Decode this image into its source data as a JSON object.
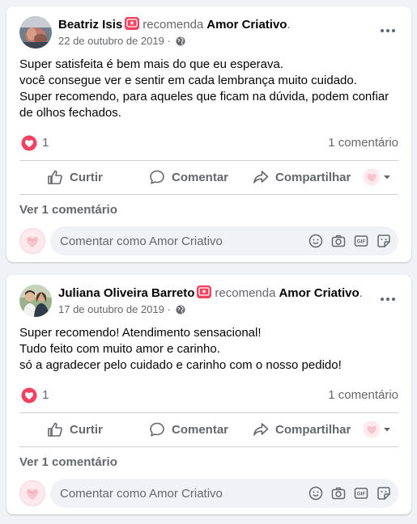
{
  "posts": [
    {
      "author": "Beatriz Isis",
      "verb": "recomenda",
      "page": "Amor Criativo",
      "date": "22 de outubro de 2019",
      "separator": "·",
      "body": [
        "Super satisfeita é bem mais do que eu esperava.",
        "você consegue ver e sentir em cada lembrança muito cuidado.",
        "Super recomendo, para aqueles que ficam na dúvida, podem confiar",
        "de olhos fechados."
      ],
      "reaction_count": "1",
      "comment_count": "1 comentário",
      "view_comments": "Ver 1 comentário",
      "composer_placeholder": "Comentar como Amor Criativo"
    },
    {
      "author": "Juliana Oliveira Barreto",
      "verb": "recomenda",
      "page": "Amor Criativo",
      "date": "17 de outubro de 2019",
      "separator": "·",
      "body": [
        "Super recomendo! Atendimento sensacional!",
        "Tudo feito com muito amor e carinho.",
        "só a agradecer pelo cuidado e carinho com o nosso pedido!"
      ],
      "reaction_count": "1",
      "comment_count": "1 comentário",
      "view_comments": "Ver 1 comentário",
      "composer_placeholder": "Comentar como Amor Criativo"
    }
  ],
  "actions": {
    "like": "Curtir",
    "comment": "Comentar",
    "share": "Compartilhar"
  },
  "icons": {
    "more": "more-options-icon",
    "globe": "globe-icon",
    "recommend": "recommend-badge-icon",
    "love": "love-reaction-icon",
    "like": "like-icon",
    "comment": "comment-icon",
    "share": "share-icon",
    "emoji": "emoji-icon",
    "camera": "camera-icon",
    "gif": "gif-icon",
    "sticker": "sticker-icon"
  },
  "colors": {
    "background": "#f0f2f5",
    "card": "#ffffff",
    "secondary_text": "#65676b",
    "love_red": "#f3425f",
    "divider": "#ced0d4"
  }
}
